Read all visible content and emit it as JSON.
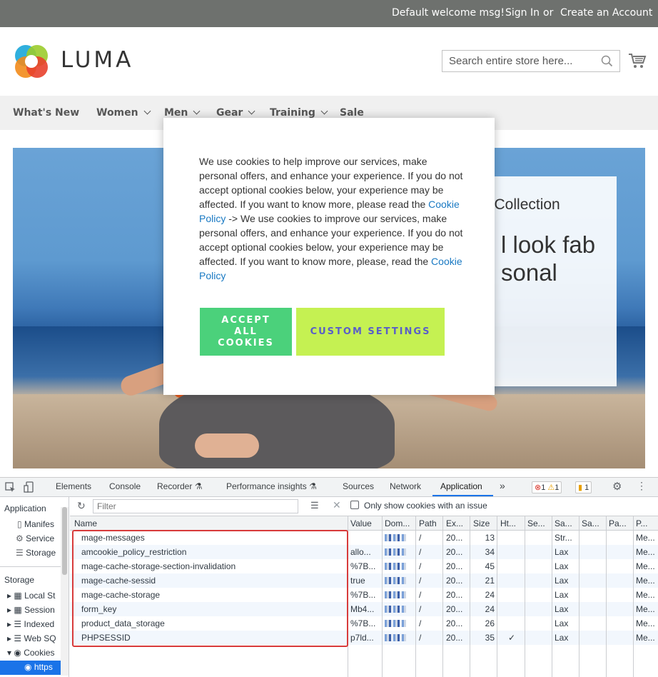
{
  "topbar": {
    "welcome": "Default welcome msg!",
    "sign_in": "Sign In",
    "or": "or",
    "create_account": "Create an Account"
  },
  "header": {
    "logo_text": "LUMA",
    "search_placeholder": "Search entire store here..."
  },
  "nav": {
    "items": [
      {
        "label": "What's New"
      },
      {
        "label": "Women"
      },
      {
        "label": "Men"
      },
      {
        "label": "Gear"
      },
      {
        "label": "Training"
      },
      {
        "label": "Sale"
      }
    ]
  },
  "hero": {
    "line1": "a Collection",
    "line2": "l look fab",
    "line3": "sonal"
  },
  "cookie_modal": {
    "text_a": "We use cookies to help improve our services, make personal offers, and enhance your experience. If you do not accept optional cookies below, your experience may be affected. If you want to know more, please read the ",
    "link1": "Cookie Policy",
    "text_b": " -> We use cookies to improve our services, make personal offers, and enhance your experience. If you do not accept optional cookies below, your experience may be affected. If you want to know more, please, read the ",
    "link2": "Cookie Policy",
    "accept_label": "ACCEPT ALL COOKIES",
    "custom_label": "CUSTOM SETTINGS"
  },
  "devtools": {
    "tabs": [
      "Elements",
      "Console",
      "Recorder",
      "Performance insights",
      "Sources",
      "Network",
      "Application"
    ],
    "active_tab": "Application",
    "more": "»",
    "errors": "1",
    "warnings": "1",
    "issues": "1",
    "filter_placeholder": "Filter",
    "only_issues_label": "Only show cookies with an issue",
    "sidebar": {
      "application_heading": "Application",
      "manifest": "Manifes",
      "service": "Service",
      "storage": "Storage",
      "storage_heading": "Storage",
      "local": "Local St",
      "session": "Session",
      "indexed": "Indexed",
      "websql": "Web SQ",
      "cookies": "Cookies",
      "https": "https"
    },
    "columns": [
      "Name",
      "Value",
      "Dom...",
      "Path",
      "Ex...",
      "Size",
      "Ht...",
      "Se...",
      "Sa...",
      "Sa...",
      "Pa...",
      "P..."
    ],
    "rows": [
      {
        "name": "mage-messages",
        "value": "",
        "path": "/",
        "expires": "20...",
        "size": "13",
        "http": "",
        "samesite": "Str...",
        "priority": "Me..."
      },
      {
        "name": "amcookie_policy_restriction",
        "value": "allo...",
        "path": "/",
        "expires": "20...",
        "size": "34",
        "http": "",
        "samesite": "Lax",
        "priority": "Me..."
      },
      {
        "name": "mage-cache-storage-section-invalidation",
        "value": "%7B...",
        "path": "/",
        "expires": "20...",
        "size": "45",
        "http": "",
        "samesite": "Lax",
        "priority": "Me..."
      },
      {
        "name": "mage-cache-sessid",
        "value": "true",
        "path": "/",
        "expires": "20...",
        "size": "21",
        "http": "",
        "samesite": "Lax",
        "priority": "Me..."
      },
      {
        "name": "mage-cache-storage",
        "value": "%7B...",
        "path": "/",
        "expires": "20...",
        "size": "24",
        "http": "",
        "samesite": "Lax",
        "priority": "Me..."
      },
      {
        "name": "form_key",
        "value": "Mb4...",
        "path": "/",
        "expires": "20...",
        "size": "24",
        "http": "",
        "samesite": "Lax",
        "priority": "Me..."
      },
      {
        "name": "product_data_storage",
        "value": "%7B...",
        "path": "/",
        "expires": "20...",
        "size": "26",
        "http": "",
        "samesite": "Lax",
        "priority": "Me..."
      },
      {
        "name": "PHPSESSID",
        "value": "p7ld...",
        "path": "/",
        "expires": "20...",
        "size": "35",
        "http": "✓",
        "samesite": "Lax",
        "priority": "Me..."
      }
    ]
  },
  "colors": {
    "accept": "#4bd17b",
    "custom": "#c5f152",
    "link": "#1979c3",
    "highlight": "#d83b3b",
    "devtools_accent": "#1a73e8"
  }
}
